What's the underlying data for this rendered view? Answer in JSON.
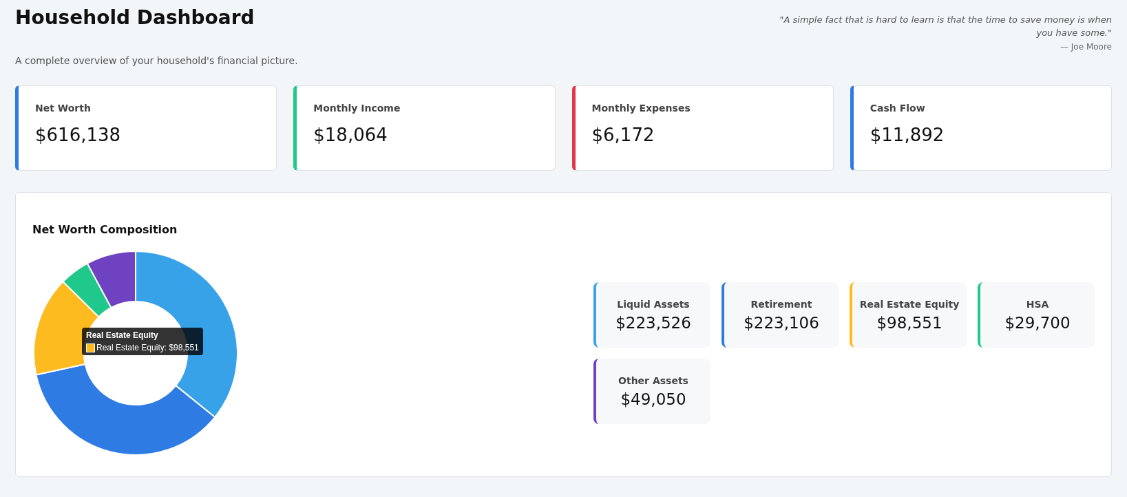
{
  "header": {
    "title": "Household Dashboard",
    "subtitle": "A complete overview of your household's financial picture.",
    "quote": "\"A simple fact that is hard to learn is that the time to save money is when you have some.\"",
    "quote_author": "— Joe Moore"
  },
  "kpis": [
    {
      "label": "Net Worth",
      "value": "$616,138",
      "color": "#2e7be3"
    },
    {
      "label": "Monthly Income",
      "value": "$18,064",
      "color": "#20c98b"
    },
    {
      "label": "Monthly Expenses",
      "value": "$6,172",
      "color": "#e0384f"
    },
    {
      "label": "Cash Flow",
      "value": "$11,892",
      "color": "#2e7be3"
    }
  ],
  "composition": {
    "title": "Net Worth Composition",
    "chart_data": {
      "type": "donut",
      "values": [
        35.82,
        35.76,
        15.8,
        4.76,
        7.86
      ]
    },
    "tooltip": {
      "title": "Real Estate Equity",
      "label": "Real Estate Equity: $98,551",
      "color": "#fdbb1f"
    },
    "assets": [
      {
        "label": "Liquid Assets",
        "value": "$223,526",
        "color": "#38a2e8"
      },
      {
        "label": "Retirement",
        "value": "$223,106",
        "color": "#2e7be3"
      },
      {
        "label": "Real Estate Equity",
        "value": "$98,551",
        "color": "#fdbb1f"
      },
      {
        "label": "HSA",
        "value": "$29,700",
        "color": "#20c98b"
      },
      {
        "label": "Other Assets",
        "value": "$49,050",
        "color": "#6f42c1"
      }
    ]
  }
}
